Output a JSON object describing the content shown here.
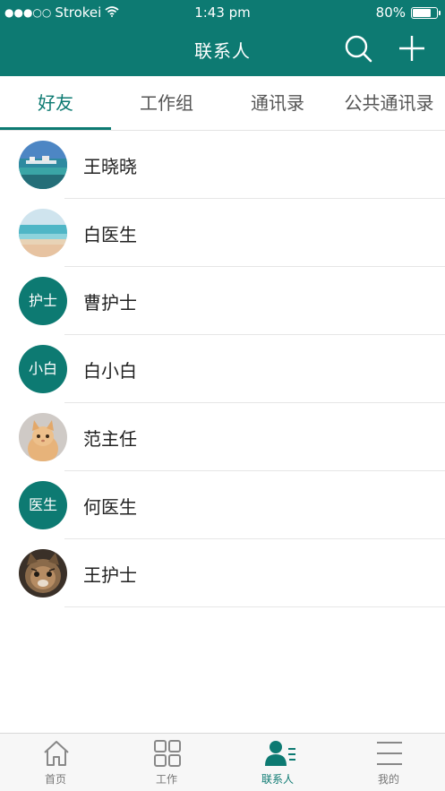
{
  "status_bar": {
    "carrier": "Strokei",
    "signal": "●●●○○",
    "time": "1:43 pm",
    "battery": "80%",
    "battery_level": 0.8
  },
  "nav": {
    "title": "联系人",
    "search_icon": "search-icon",
    "add_icon": "plus-icon"
  },
  "tabs": [
    {
      "label": "好友",
      "active": true
    },
    {
      "label": "工作组",
      "active": false
    },
    {
      "label": "通讯录",
      "active": false
    },
    {
      "label": "公共通讯录",
      "active": false
    }
  ],
  "contacts": [
    {
      "name": "王晓晓",
      "avatar": "photo-sea-pier"
    },
    {
      "name": "白医生",
      "avatar": "photo-beach"
    },
    {
      "name": "曹护士",
      "avatar_text": "护士"
    },
    {
      "name": "白小白",
      "avatar_text": "小白"
    },
    {
      "name": "范主任",
      "avatar": "photo-kitten"
    },
    {
      "name": "何医生",
      "avatar_text": "医生"
    },
    {
      "name": "王护士",
      "avatar": "photo-cat"
    }
  ],
  "tabbar": [
    {
      "label": "首页",
      "icon": "home-icon",
      "active": false
    },
    {
      "label": "工作",
      "icon": "grid-icon",
      "active": false
    },
    {
      "label": "联系人",
      "icon": "contacts-icon",
      "active": true
    },
    {
      "label": "我的",
      "icon": "menu-icon",
      "active": false
    }
  ],
  "colors": {
    "brand": "#0d7a72",
    "inactive_text": "#777777"
  }
}
